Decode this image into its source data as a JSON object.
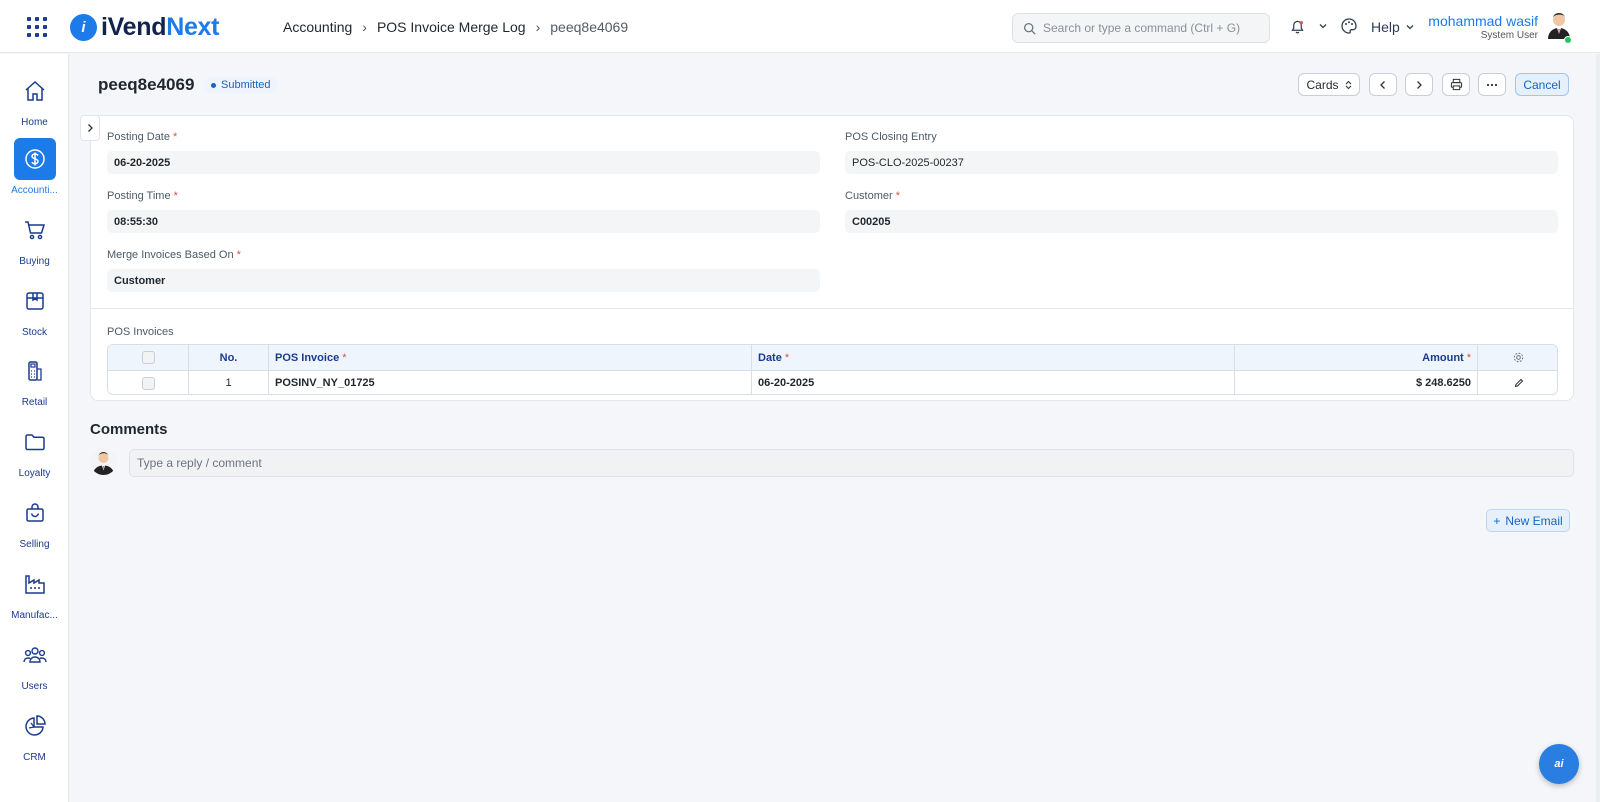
{
  "app": {
    "brand_prefix": "iVend",
    "brand_suffix": "Next",
    "logo_mark": "i"
  },
  "breadcrumb": [
    "Accounting",
    "POS Invoice Merge Log",
    "peeq8e4069"
  ],
  "search": {
    "placeholder": "Search or type a command (Ctrl + G)"
  },
  "topbar": {
    "help_label": "Help",
    "user_name": "mohammad wasif",
    "user_role": "System User"
  },
  "sidebar": {
    "items": [
      {
        "label": "Home",
        "icon": "home-icon",
        "active": false
      },
      {
        "label": "Accounti...",
        "icon": "dollar-icon",
        "active": true
      },
      {
        "label": "Buying",
        "icon": "cart-icon",
        "active": false
      },
      {
        "label": "Stock",
        "icon": "box-icon",
        "active": false
      },
      {
        "label": "Retail",
        "icon": "pos-terminal-icon",
        "active": false
      },
      {
        "label": "Loyalty",
        "icon": "folder-icon",
        "active": false
      },
      {
        "label": "Selling",
        "icon": "shopping-bag-icon",
        "active": false
      },
      {
        "label": "Manufac...",
        "icon": "factory-icon",
        "active": false
      },
      {
        "label": "Users",
        "icon": "users-icon",
        "active": false
      },
      {
        "label": "CRM",
        "icon": "pie-chart-icon",
        "active": false
      }
    ]
  },
  "doc": {
    "title": "peeq8e4069",
    "status": "Submitted",
    "view_selector": "Cards",
    "cancel_label": "Cancel"
  },
  "form": {
    "posting_date_label": "Posting Date",
    "posting_date": "06-20-2025",
    "posting_time_label": "Posting Time",
    "posting_time": "08:55:30",
    "merge_based_on_label": "Merge Invoices Based On",
    "merge_based_on": "Customer",
    "pos_closing_entry_label": "POS Closing Entry",
    "pos_closing_entry": "POS-CLO-2025-00237",
    "customer_label": "Customer",
    "customer": "C00205",
    "required_mark": "*"
  },
  "pos_invoices": {
    "section_label": "POS Invoices",
    "columns": [
      "No.",
      "POS Invoice",
      "Date",
      "Amount"
    ],
    "rows": [
      {
        "no": "1",
        "pos_invoice": "POSINV_NY_01725",
        "date": "06-20-2025",
        "amount": "$ 248.6250"
      }
    ]
  },
  "comments": {
    "title": "Comments",
    "placeholder": "Type a reply / comment"
  },
  "actions": {
    "new_email_label": "New Email"
  },
  "fab": {
    "label": "ai"
  },
  "colors": {
    "accent": "#1c7be8",
    "brand_dark": "#12244d",
    "required": "#e24c4c",
    "online": "#22c55e"
  }
}
